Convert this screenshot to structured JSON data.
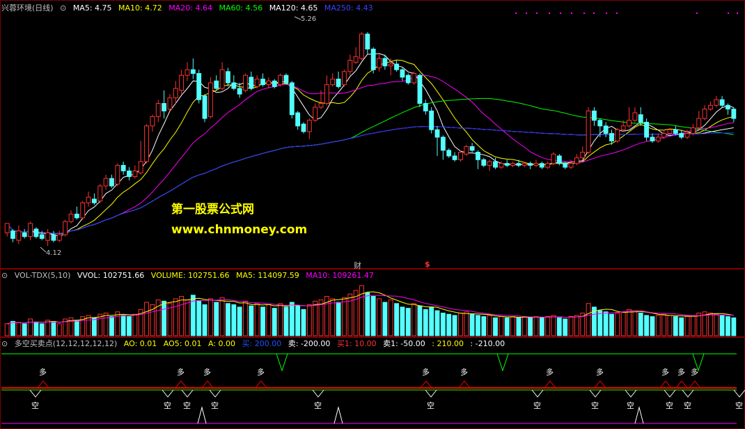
{
  "colors": {
    "bg": "#000000",
    "up": "#ff3232",
    "down": "#54ffff",
    "ma5": "#ffffff",
    "ma10": "#ffff00",
    "ma20": "#ff00ff",
    "ma60": "#00ff00",
    "ma120": "#ffffff",
    "ma250": "#2020ff",
    "grid": "#800000"
  },
  "main_legend": {
    "title": "兴蓉环境(日线)",
    "ma5": "MA5: 4.75",
    "ma10": "MA10: 4.72",
    "ma20": "MA20: 4.64",
    "ma60": "MA60: 4.56",
    "ma120": "MA120: 4.65",
    "ma250": "MA250: 4.43"
  },
  "vol_legend": {
    "title": "VOL-TDX(5,10)",
    "vvol": "VVOL: 102751.66",
    "volume": "VOLUME: 102751.66",
    "ma5": "MA5: 114097.59",
    "ma10": "MA10: 109261.47"
  },
  "sig_legend": {
    "title": "多空买卖点(12,12,12,12,12)",
    "ao": "AO: 0.01",
    "ao5": "AO5: 0.01",
    "a": "A: 0.00",
    "buy": "买: 200.00",
    "sell": "卖: -200.00",
    "buy1": "买1: 10.00",
    "sell1": "卖1: -50.00",
    "v210": ": 210.00",
    "vm210": ": -210.00"
  },
  "annotations": {
    "high_label": "5.26",
    "low_label": "4.12",
    "fin_marker": "财",
    "div_marker": "$",
    "watermark_cn": "第一股票公式网",
    "watermark_url": "www.chnmoney.com"
  },
  "signals": {
    "long_label": "多",
    "short_label": "空"
  },
  "chart_data": [
    {
      "type": "candlestick",
      "title": "兴蓉环境(日线)",
      "ylim": [
        4.05,
        5.35
      ],
      "high": 5.26,
      "low": 4.12,
      "candles": [
        [
          4.19,
          4.24,
          4.24,
          4.17
        ],
        [
          4.2,
          4.16,
          4.21,
          4.14
        ],
        [
          4.15,
          4.2,
          4.23,
          4.13
        ],
        [
          4.19,
          4.17,
          4.21,
          4.16
        ],
        [
          4.17,
          4.24,
          4.25,
          4.15
        ],
        [
          4.21,
          4.17,
          4.22,
          4.16
        ],
        [
          4.18,
          4.16,
          4.2,
          4.15
        ],
        [
          4.15,
          4.19,
          4.21,
          4.12
        ],
        [
          4.18,
          4.15,
          4.2,
          4.14
        ],
        [
          4.15,
          4.18,
          4.2,
          4.14
        ],
        [
          4.18,
          4.25,
          4.26,
          4.17
        ],
        [
          4.25,
          4.29,
          4.31,
          4.24
        ],
        [
          4.29,
          4.27,
          4.33,
          4.26
        ],
        [
          4.27,
          4.35,
          4.36,
          4.26
        ],
        [
          4.35,
          4.38,
          4.41,
          4.33
        ],
        [
          4.37,
          4.35,
          4.4,
          4.34
        ],
        [
          4.36,
          4.44,
          4.45,
          4.35
        ],
        [
          4.44,
          4.48,
          4.5,
          4.42
        ],
        [
          4.48,
          4.44,
          4.5,
          4.43
        ],
        [
          4.45,
          4.55,
          4.56,
          4.44
        ],
        [
          4.55,
          4.52,
          4.57,
          4.5
        ],
        [
          4.52,
          4.49,
          4.54,
          4.47
        ],
        [
          4.49,
          4.52,
          4.55,
          4.48
        ],
        [
          4.51,
          4.57,
          4.68,
          4.5
        ],
        [
          4.57,
          4.76,
          4.77,
          4.56
        ],
        [
          4.76,
          4.81,
          4.82,
          4.73
        ],
        [
          4.81,
          4.88,
          4.9,
          4.78
        ],
        [
          4.88,
          4.84,
          4.95,
          4.8
        ],
        [
          4.85,
          4.91,
          4.93,
          4.84
        ],
        [
          4.91,
          4.96,
          5.0,
          4.88
        ],
        [
          4.95,
          5.03,
          5.06,
          4.93
        ],
        [
          5.03,
          5.06,
          5.1,
          5.0
        ],
        [
          5.06,
          5.04,
          5.12,
          5.01
        ],
        [
          5.04,
          4.9,
          5.06,
          4.88
        ],
        [
          4.92,
          4.8,
          4.93,
          4.78
        ],
        [
          4.81,
          4.99,
          5.02,
          4.8
        ],
        [
          5.0,
          4.96,
          5.03,
          4.95
        ],
        [
          4.96,
          5.06,
          5.1,
          4.95
        ],
        [
          5.05,
          4.99,
          5.07,
          4.97
        ],
        [
          4.99,
          4.96,
          5.03,
          4.95
        ],
        [
          4.96,
          4.93,
          4.99,
          4.91
        ],
        [
          4.95,
          5.03,
          5.04,
          4.94
        ],
        [
          5.02,
          4.96,
          5.05,
          4.95
        ],
        [
          4.97,
          5.01,
          5.03,
          4.96
        ],
        [
          5.01,
          4.98,
          5.04,
          4.97
        ],
        [
          4.98,
          5.0,
          5.02,
          4.96
        ],
        [
          5.0,
          4.97,
          5.01,
          4.96
        ],
        [
          4.98,
          5.03,
          5.04,
          4.97
        ],
        [
          5.03,
          4.99,
          5.04,
          4.98
        ],
        [
          4.99,
          4.82,
          5.0,
          4.8
        ],
        [
          4.83,
          4.76,
          4.84,
          4.74
        ],
        [
          4.77,
          4.73,
          4.78,
          4.72
        ],
        [
          4.73,
          4.79,
          4.8,
          4.69
        ],
        [
          4.79,
          4.86,
          4.88,
          4.78
        ],
        [
          4.86,
          4.88,
          4.95,
          4.85
        ],
        [
          4.88,
          4.98,
          5.03,
          4.87
        ],
        [
          4.98,
          5.01,
          5.04,
          4.97
        ],
        [
          5.01,
          4.97,
          5.05,
          4.96
        ],
        [
          4.98,
          5.05,
          5.06,
          4.97
        ],
        [
          5.05,
          5.11,
          5.14,
          5.03
        ],
        [
          5.1,
          5.13,
          5.18,
          5.09
        ],
        [
          5.12,
          5.25,
          5.26,
          5.11
        ],
        [
          5.25,
          5.17,
          5.26,
          5.14
        ],
        [
          5.17,
          5.06,
          5.18,
          5.04
        ],
        [
          5.07,
          5.12,
          5.14,
          5.05
        ],
        [
          5.12,
          5.08,
          5.14,
          5.06
        ],
        [
          5.08,
          5.09,
          5.12,
          5.03
        ],
        [
          5.09,
          5.06,
          5.11,
          5.05
        ],
        [
          5.06,
          5.02,
          5.07,
          5.0
        ],
        [
          5.03,
          4.99,
          5.04,
          4.98
        ],
        [
          4.99,
          5.04,
          5.05,
          4.98
        ],
        [
          5.03,
          4.88,
          5.04,
          4.86
        ],
        [
          4.88,
          4.84,
          4.9,
          4.82
        ],
        [
          4.84,
          4.74,
          4.86,
          4.72
        ],
        [
          4.74,
          4.7,
          4.76,
          4.6
        ],
        [
          4.7,
          4.63,
          4.71,
          4.58
        ],
        [
          4.63,
          4.6,
          4.64,
          4.59
        ],
        [
          4.6,
          4.58,
          4.62,
          4.57
        ],
        [
          4.58,
          4.62,
          4.63,
          4.57
        ],
        [
          4.61,
          4.65,
          4.66,
          4.6
        ],
        [
          4.65,
          4.63,
          4.67,
          4.62
        ],
        [
          4.62,
          4.58,
          4.63,
          4.53
        ],
        [
          4.58,
          4.55,
          4.59,
          4.54
        ],
        [
          4.55,
          4.57,
          4.58,
          4.52
        ],
        [
          4.57,
          4.54,
          4.59,
          4.53
        ],
        [
          4.54,
          4.56,
          4.57,
          4.53
        ],
        [
          4.56,
          4.55,
          4.58,
          4.54
        ],
        [
          4.55,
          4.56,
          4.57,
          4.54
        ],
        [
          4.56,
          4.55,
          4.58,
          4.54
        ],
        [
          4.55,
          4.56,
          4.57,
          4.54
        ],
        [
          4.56,
          4.55,
          4.57,
          4.53
        ],
        [
          4.55,
          4.56,
          4.58,
          4.54
        ],
        [
          4.56,
          4.54,
          4.57,
          4.53
        ],
        [
          4.54,
          4.56,
          4.57,
          4.53
        ],
        [
          4.56,
          4.61,
          4.62,
          4.55
        ],
        [
          4.6,
          4.56,
          4.61,
          4.55
        ],
        [
          4.56,
          4.54,
          4.57,
          4.53
        ],
        [
          4.54,
          4.56,
          4.58,
          4.53
        ],
        [
          4.56,
          4.59,
          4.61,
          4.55
        ],
        [
          4.59,
          4.62,
          4.65,
          4.58
        ],
        [
          4.62,
          4.84,
          4.86,
          4.61
        ],
        [
          4.84,
          4.79,
          4.86,
          4.76
        ],
        [
          4.79,
          4.76,
          4.8,
          4.7
        ],
        [
          4.76,
          4.72,
          4.78,
          4.7
        ],
        [
          4.72,
          4.68,
          4.74,
          4.66
        ],
        [
          4.68,
          4.74,
          4.75,
          4.67
        ],
        [
          4.74,
          4.76,
          4.79,
          4.73
        ],
        [
          4.76,
          4.79,
          4.86,
          4.75
        ],
        [
          4.79,
          4.83,
          4.86,
          4.78
        ],
        [
          4.82,
          4.78,
          4.86,
          4.76
        ],
        [
          4.78,
          4.7,
          4.8,
          4.68
        ],
        [
          4.7,
          4.68,
          4.72,
          4.67
        ],
        [
          4.68,
          4.7,
          4.72,
          4.67
        ],
        [
          4.7,
          4.72,
          4.74,
          4.69
        ],
        [
          4.72,
          4.74,
          4.75,
          4.71
        ],
        [
          4.74,
          4.72,
          4.76,
          4.71
        ],
        [
          4.72,
          4.7,
          4.74,
          4.69
        ],
        [
          4.7,
          4.72,
          4.74,
          4.69
        ],
        [
          4.72,
          4.75,
          4.77,
          4.71
        ],
        [
          4.75,
          4.8,
          4.84,
          4.74
        ],
        [
          4.8,
          4.85,
          4.87,
          4.79
        ],
        [
          4.85,
          4.87,
          4.89,
          4.84
        ],
        [
          4.87,
          4.9,
          4.92,
          4.86
        ],
        [
          4.9,
          4.87,
          4.92,
          4.86
        ],
        [
          4.87,
          4.85,
          4.88,
          4.82
        ],
        [
          4.85,
          4.8,
          4.86,
          4.78
        ]
      ]
    },
    {
      "type": "bar",
      "title": "VOL-TDX(5,10)",
      "series": [
        {
          "name": "VOLUME",
          "values": [
            10,
            12,
            11,
            10,
            14,
            11,
            10,
            13,
            12,
            10,
            14,
            15,
            13,
            16,
            17,
            15,
            18,
            19,
            16,
            20,
            17,
            16,
            18,
            22,
            28,
            26,
            30,
            29,
            27,
            31,
            33,
            30,
            34,
            29,
            26,
            31,
            28,
            32,
            27,
            26,
            24,
            29,
            25,
            27,
            24,
            26,
            23,
            27,
            24,
            28,
            25,
            22,
            26,
            29,
            30,
            33,
            31,
            28,
            32,
            35,
            38,
            42,
            36,
            33,
            31,
            28,
            30,
            27,
            24,
            23,
            27,
            25,
            22,
            24,
            21,
            19,
            18,
            17,
            19,
            20,
            18,
            17,
            16,
            17,
            15,
            16,
            15,
            16,
            15,
            16,
            15,
            16,
            15,
            16,
            17,
            15,
            14,
            16,
            17,
            19,
            27,
            24,
            21,
            20,
            18,
            19,
            20,
            22,
            21,
            19,
            17,
            16,
            17,
            18,
            17,
            16,
            15,
            16,
            17,
            19,
            20,
            19,
            18,
            17,
            16,
            15
          ]
        }
      ],
      "legend": [
        "VVOL",
        "VOLUME",
        "MA5",
        "MA10"
      ]
    },
    {
      "type": "line",
      "title": "多空买卖点(12,12,12,12,12)",
      "long_signal_labels": [
        "多",
        "多",
        "多",
        "多",
        "多",
        "多",
        "多",
        "多",
        "多",
        "多",
        "多"
      ],
      "short_signal_labels": [
        "空",
        "空",
        "空",
        "空",
        "空",
        "空",
        "空",
        "空",
        "空",
        "空",
        "空",
        "空"
      ]
    }
  ]
}
